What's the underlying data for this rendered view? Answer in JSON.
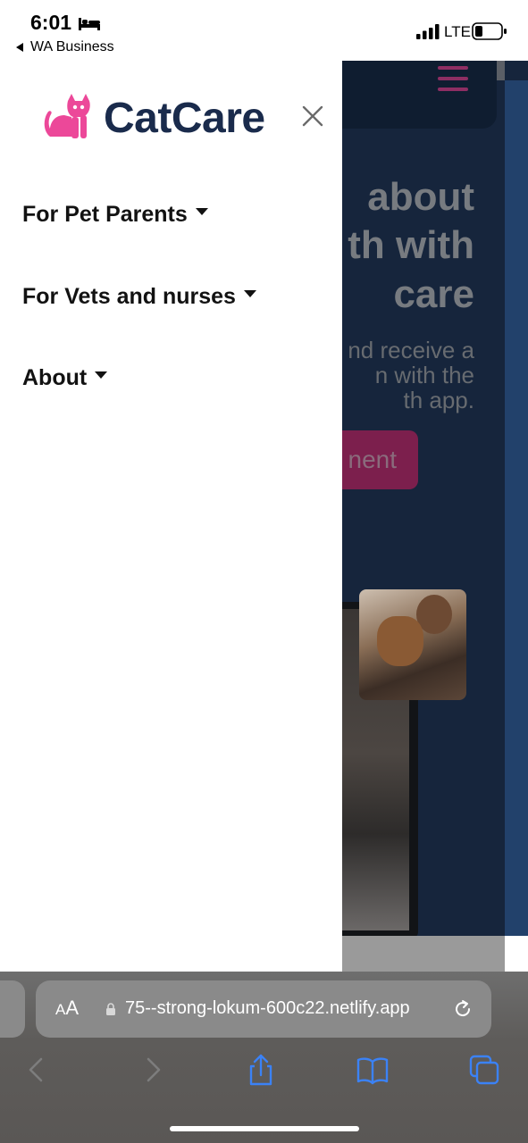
{
  "status_bar": {
    "time": "6:01",
    "back_app": "WA Business",
    "network": "LTE"
  },
  "drawer": {
    "brand": "CatCare",
    "nav_items": [
      {
        "label": "For Pet Parents"
      },
      {
        "label": "For Vets and nurses"
      },
      {
        "label": "About"
      }
    ]
  },
  "background_page": {
    "hero_lines": [
      "about",
      "th with",
      "care"
    ],
    "subtitle_lines": [
      "nd receive a",
      "n with the",
      "th app."
    ],
    "cta_label": "nent"
  },
  "browser": {
    "aa_big": "A",
    "aa_small": "A",
    "url": "75--strong-lokum-600c22.netlify.app"
  },
  "colors": {
    "brand_pink": "#ec4899",
    "brand_navy": "#1a2b4c",
    "ios_blue": "#3b82f6"
  }
}
